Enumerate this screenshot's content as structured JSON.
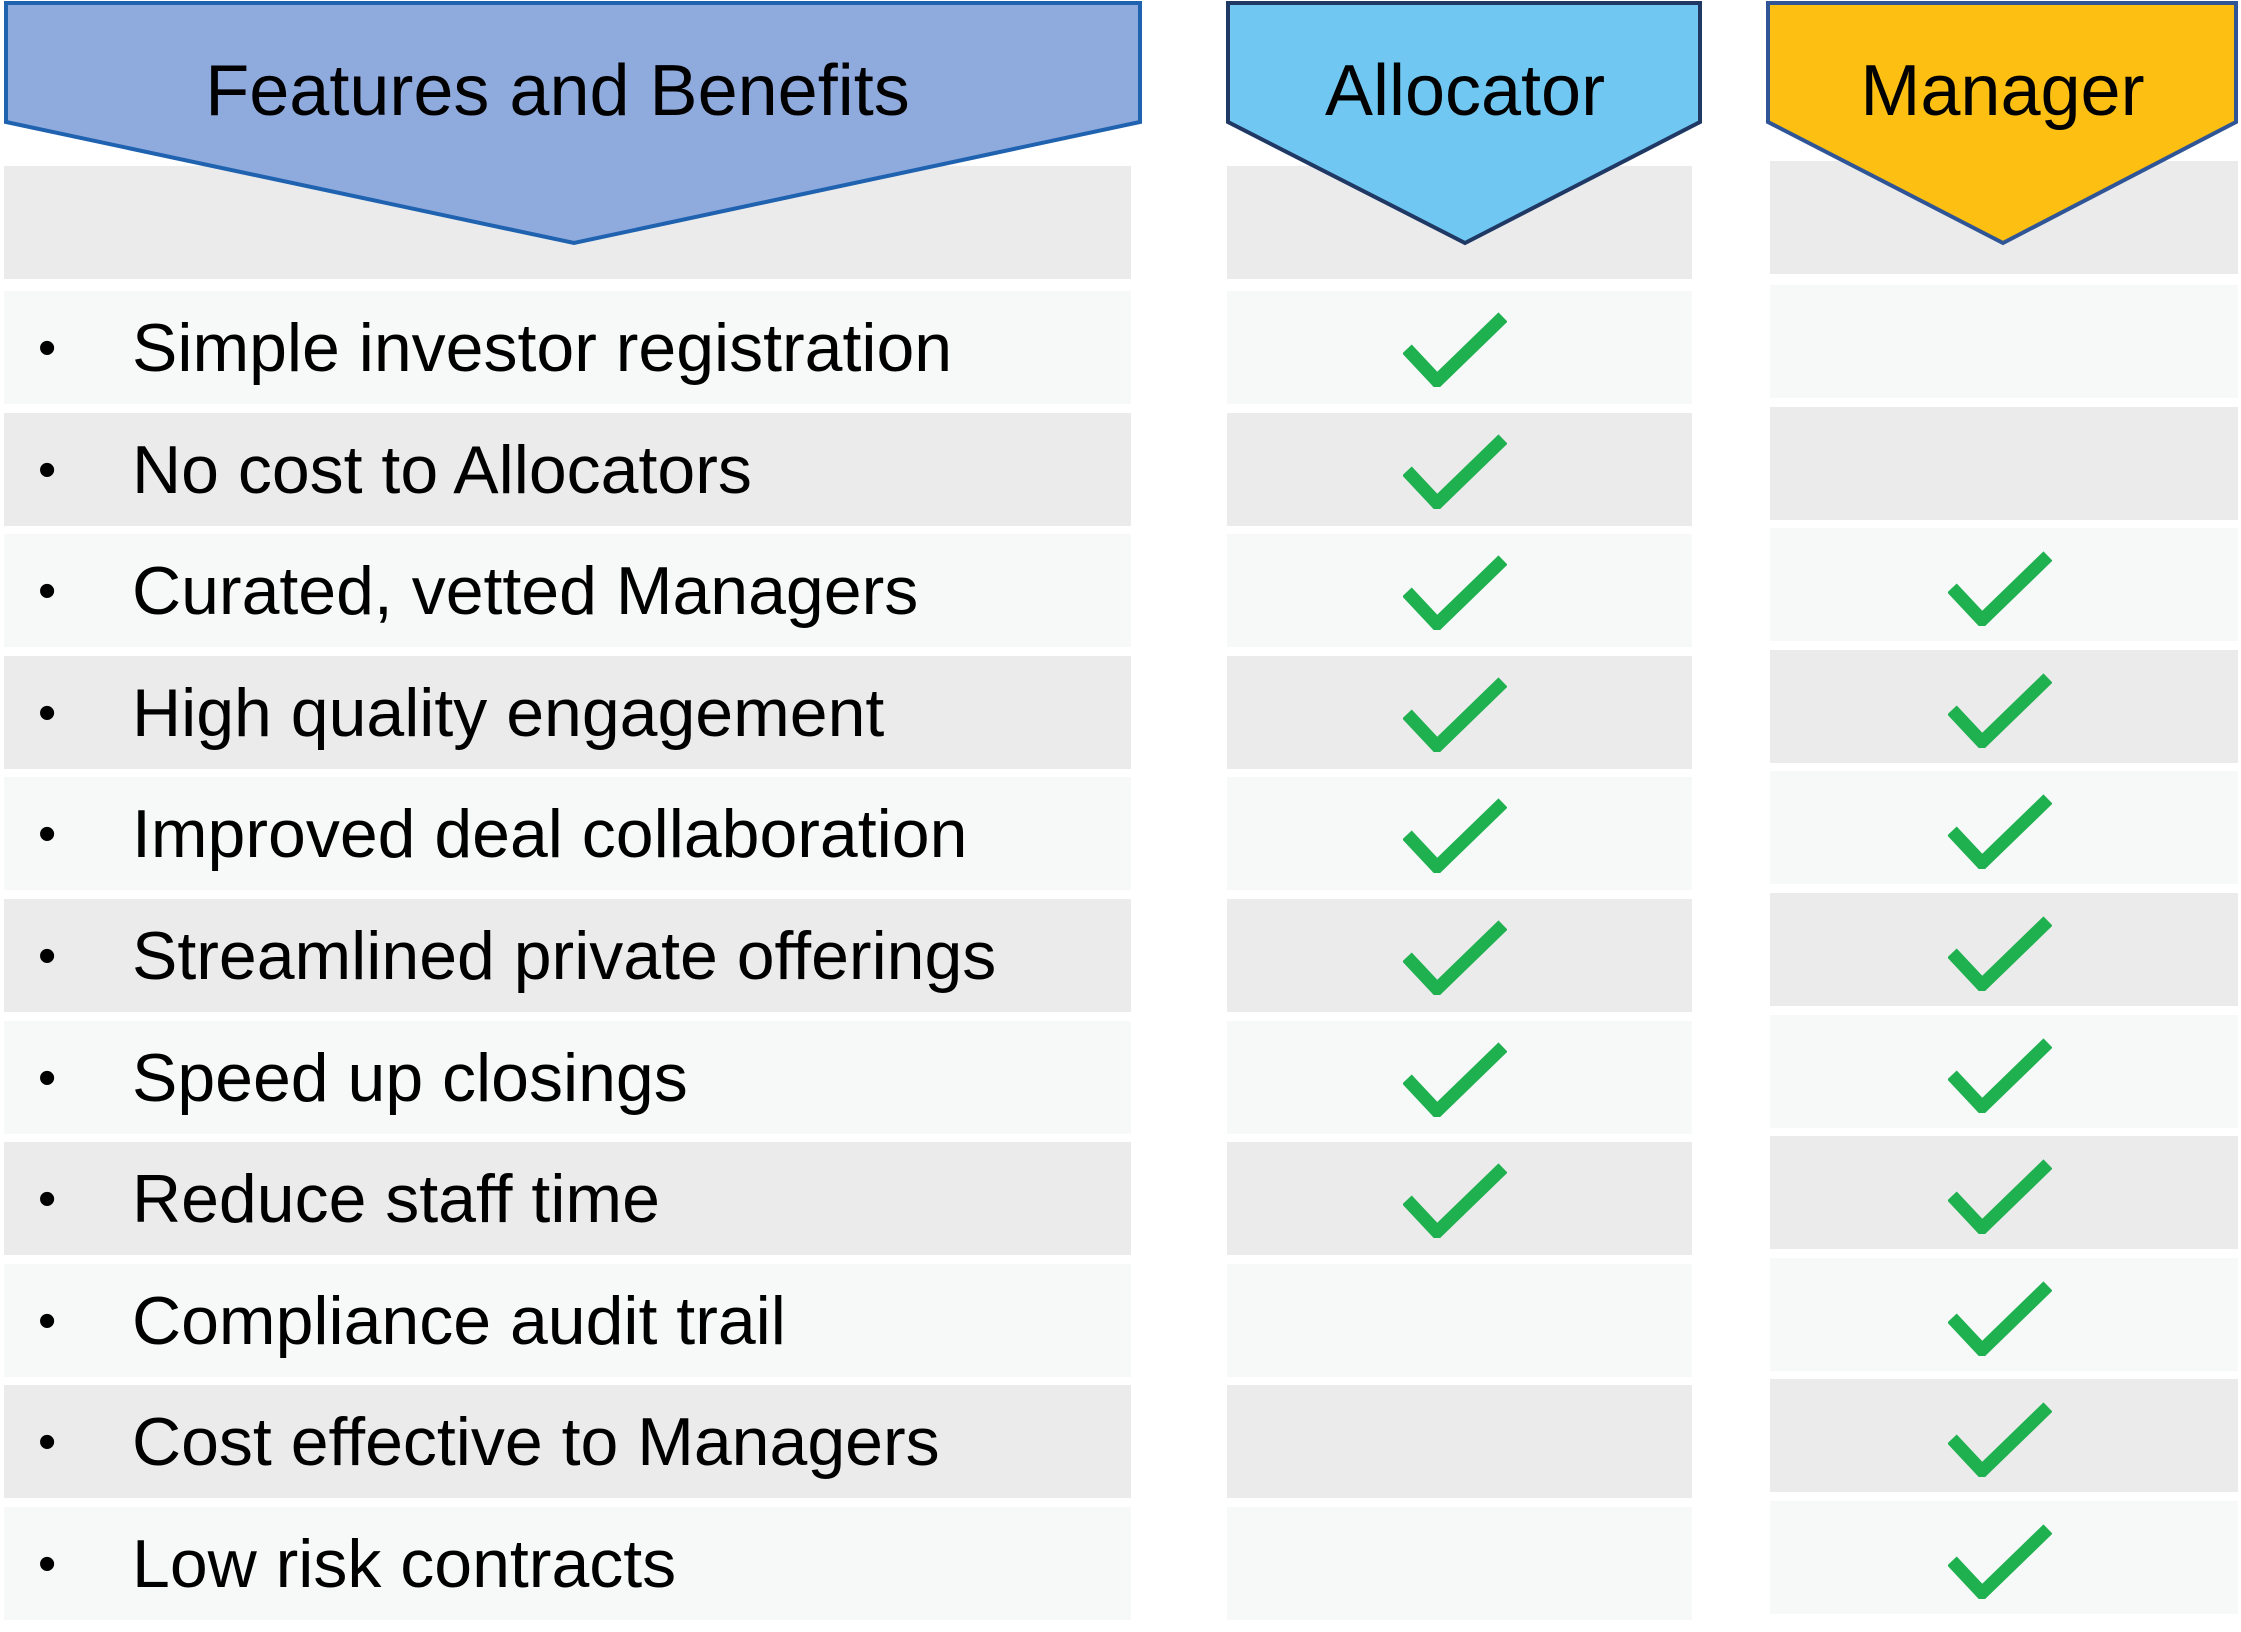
{
  "headers": {
    "features": "Features and Benefits",
    "allocator": "Allocator",
    "manager": "Manager"
  },
  "colors": {
    "features_fill": "#8faadc",
    "features_stroke": "#1f62b0",
    "allocator_fill": "#70c8f2",
    "allocator_stroke": "#1f3864",
    "manager_fill": "#fcbf12",
    "manager_stroke": "#2f5597",
    "check": "#1fb04f",
    "row_light": "#f7f9f9",
    "row_dark": "#ebebeb"
  },
  "bullet_glyph": "•",
  "rows": [
    {
      "feature": "Simple investor registration",
      "allocator": true,
      "manager": false
    },
    {
      "feature": "No cost to Allocators",
      "allocator": true,
      "manager": false
    },
    {
      "feature": "Curated, vetted Managers",
      "allocator": true,
      "manager": true
    },
    {
      "feature": "High quality engagement",
      "allocator": true,
      "manager": true
    },
    {
      "feature": "Improved deal collaboration",
      "allocator": true,
      "manager": true
    },
    {
      "feature": "Streamlined private offerings",
      "allocator": true,
      "manager": true
    },
    {
      "feature": "Speed up closings",
      "allocator": true,
      "manager": true
    },
    {
      "feature": "Reduce staff time",
      "allocator": true,
      "manager": true
    },
    {
      "feature": "Compliance audit trail",
      "allocator": false,
      "manager": true
    },
    {
      "feature": "Cost effective to Managers",
      "allocator": false,
      "manager": true
    },
    {
      "feature": "Low risk contracts",
      "allocator": false,
      "manager": true
    }
  ]
}
